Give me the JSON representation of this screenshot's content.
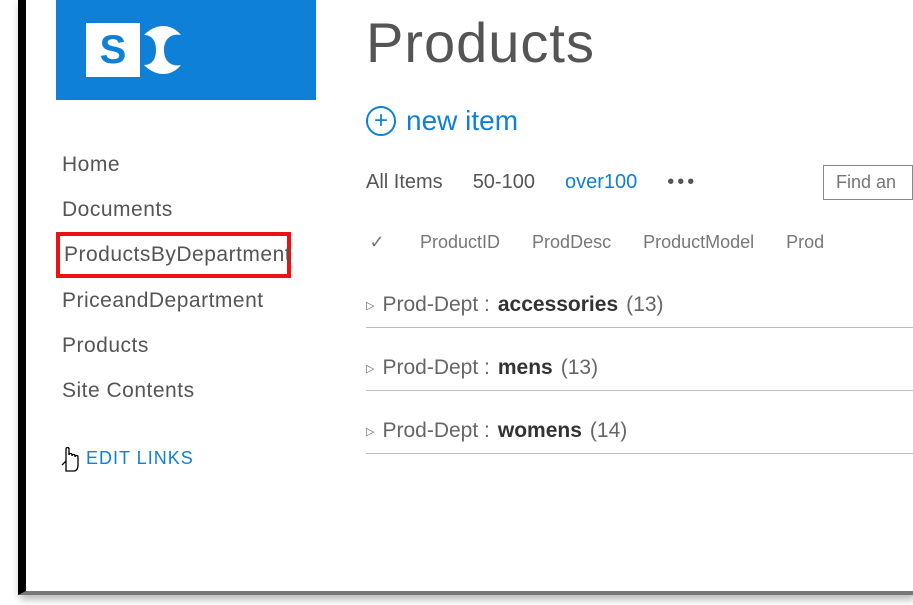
{
  "page": {
    "title": "Products"
  },
  "sidebar": {
    "items": [
      {
        "label": "Home"
      },
      {
        "label": "Documents"
      },
      {
        "label": "ProductsByDepartment"
      },
      {
        "label": "PriceandDepartment"
      },
      {
        "label": "Products"
      },
      {
        "label": "Site Contents"
      }
    ],
    "edit_links_label": "EDIT LINKS"
  },
  "toolbar": {
    "new_item_label": "new item"
  },
  "views": {
    "items": [
      {
        "label": "All Items"
      },
      {
        "label": "50-100"
      },
      {
        "label": "over100"
      }
    ],
    "more": "•••"
  },
  "search": {
    "placeholder": "Find an"
  },
  "columns": [
    "ProductID",
    "ProdDesc",
    "ProductModel",
    "Prod"
  ],
  "groups": [
    {
      "label": "Prod-Dept :",
      "value": "accessories",
      "count": "(13)"
    },
    {
      "label": "Prod-Dept :",
      "value": "mens",
      "count": "(13)"
    },
    {
      "label": "Prod-Dept :",
      "value": "womens",
      "count": "(14)"
    }
  ]
}
